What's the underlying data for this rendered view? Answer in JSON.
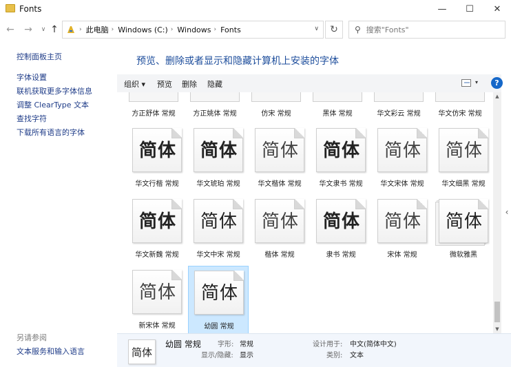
{
  "window": {
    "title": "Fonts",
    "minimize": "—",
    "maximize": "☐",
    "close": "✕"
  },
  "nav": {
    "back": "←",
    "forward": "→",
    "recent": "∨",
    "up": "↑",
    "breadcrumbs": [
      "此电脑",
      "Windows (C:)",
      "Windows",
      "Fonts"
    ],
    "separator": "›",
    "dropdown": "∨",
    "refresh": "↻",
    "search_icon": "⚲",
    "search_placeholder": "搜索\"Fonts\""
  },
  "sidebar": {
    "home": "控制面板主页",
    "links": [
      "字体设置",
      "联机获取更多字体信息",
      "调整 ClearType 文本",
      "查找字符",
      "下载所有语言的字体"
    ],
    "see_also_title": "另请参阅",
    "see_also_links": [
      "文本服务和输入语言"
    ]
  },
  "main": {
    "heading": "预览、删除或者显示和隐藏计算机上安装的字体"
  },
  "toolbar": {
    "organize": "组织 ▾",
    "preview": "预览",
    "delete": "删除",
    "hide": "隐藏",
    "view_dropdown": "▾",
    "help": "?"
  },
  "partial_row": [
    "方正舒体 常规",
    "方正姚体 常规",
    "仿宋 常规",
    "黑体 常规",
    "华文彩云 常规",
    "华文仿宋 常规"
  ],
  "fonts": [
    {
      "label": "华文行楷 常规",
      "sample": "简体",
      "style": "bold"
    },
    {
      "label": "华文琥珀 常规",
      "sample": "简体",
      "style": "bold"
    },
    {
      "label": "华文楷体 常规",
      "sample": "简体",
      "style": "light"
    },
    {
      "label": "华文隶书 常规",
      "sample": "简体",
      "style": "bold"
    },
    {
      "label": "华文宋体 常规",
      "sample": "简体",
      "style": "light"
    },
    {
      "label": "华文细黑 常规",
      "sample": "简体",
      "style": "light"
    },
    {
      "label": "华文新魏 常规",
      "sample": "简体",
      "style": "bold"
    },
    {
      "label": "华文中宋 常规",
      "sample": "简体",
      "style": "normal"
    },
    {
      "label": "楷体 常规",
      "sample": "简体",
      "style": "light"
    },
    {
      "label": "隶书 常规",
      "sample": "简体",
      "style": "bold"
    },
    {
      "label": "宋体 常规",
      "sample": "简体",
      "style": "light"
    },
    {
      "label": "微软雅黑",
      "sample": "简体",
      "style": "normal",
      "stacked": true
    },
    {
      "label": "新宋体 常规",
      "sample": "简体",
      "style": "light"
    },
    {
      "label": "幼圆 常规",
      "sample": "简体",
      "style": "normal",
      "selected": true
    }
  ],
  "scroll": {
    "up": "▲",
    "down": "▼",
    "side_tab": "‹"
  },
  "details": {
    "thumb": "简体",
    "name": "幼圆 常规",
    "style_key": "字形:",
    "style_val": "常规",
    "show_key": "显示/隐藏:",
    "show_val": "显示",
    "designed_key": "设计用于:",
    "designed_val": "中文(简体中文)",
    "category_key": "类别:",
    "category_val": "文本"
  },
  "colors": {
    "link": "#1f3c88",
    "heading": "#1e4e9c",
    "selection": "#cce8ff",
    "help": "#1668c9"
  }
}
